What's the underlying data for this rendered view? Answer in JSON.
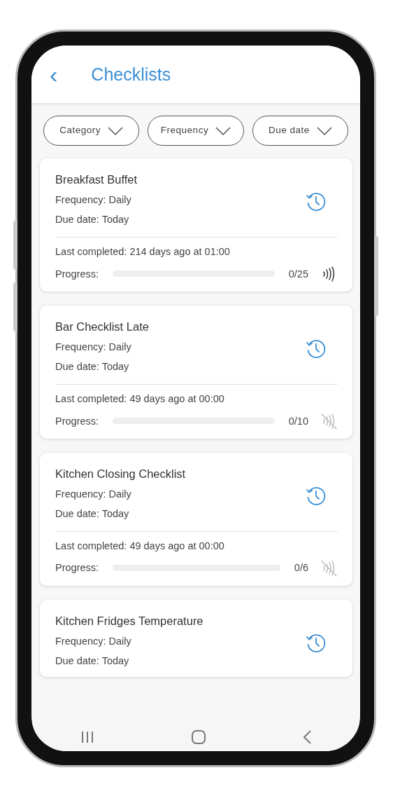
{
  "header": {
    "back": "‹",
    "title": "Checklists"
  },
  "filters": [
    {
      "label": "Category"
    },
    {
      "label": "Frequency"
    },
    {
      "label": "Due date"
    }
  ],
  "checklists": [
    {
      "name": "Breakfast Buffet",
      "frequency": "Frequency: Daily",
      "due": "Due date: Today",
      "last_completed": "Last completed: 214 days ago at 01:00",
      "progress_label": "Progress:",
      "level": 0,
      "count": "0/25",
      "nfc": true
    },
    {
      "name": "Bar Checklist Late",
      "frequency": "Frequency: Daily",
      "due": "Due date: Today",
      "last_completed": "Last completed: 49 days ago at 00:00",
      "progress_label": "Progress:",
      "level": 0,
      "count": "0/10",
      "nfc": false
    },
    {
      "name": "Kitchen Closing Checklist",
      "frequency": "Frequency: Daily",
      "due": "Due date: Today",
      "last_completed": "Last completed: 49 days ago at 00:00",
      "progress_label": "Progress:",
      "level": 0,
      "count": "0/6",
      "nfc": false
    },
    {
      "name": "Kitchen Fridges Temperature",
      "frequency": "Frequency: Daily",
      "due": "Due date: Today"
    }
  ]
}
